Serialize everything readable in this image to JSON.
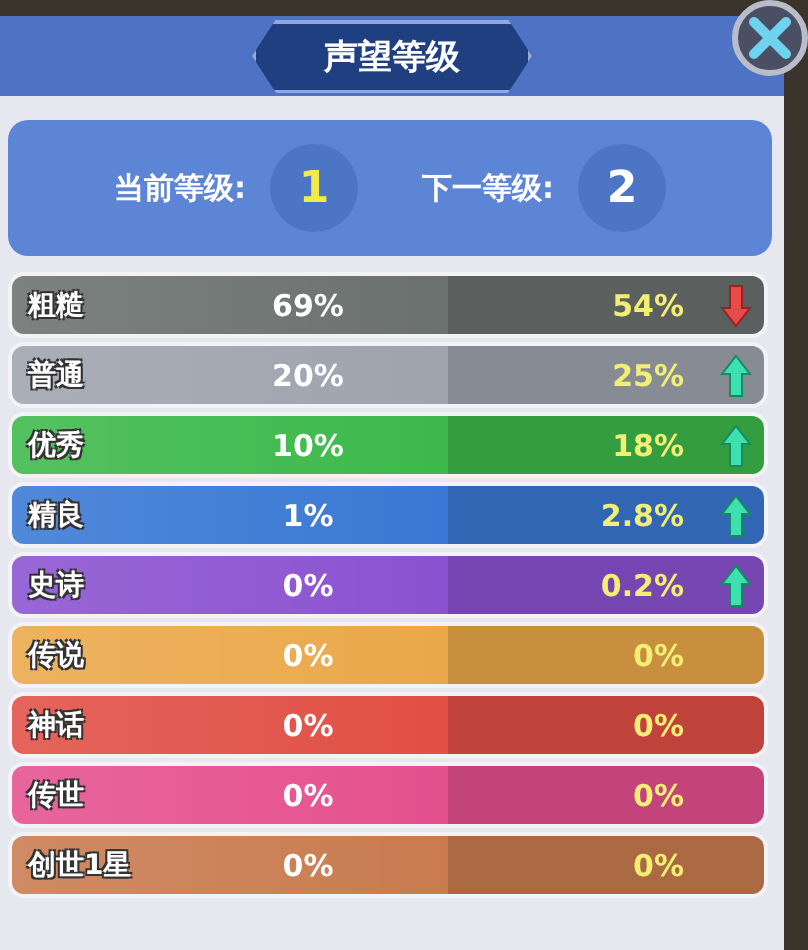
{
  "title": "声望等级",
  "levels": {
    "current_label": "当前等级:",
    "current": "1",
    "next_label": "下一等级:",
    "next": "2"
  },
  "rows": [
    {
      "kind": "down",
      "name": "粗糙",
      "now": "69%",
      "next": "54%",
      "color": "#6b716f"
    },
    {
      "kind": "up",
      "name": "普通",
      "now": "20%",
      "next": "25%",
      "color": "#9ea3ae"
    },
    {
      "kind": "up",
      "name": "优秀",
      "now": "10%",
      "next": "18%",
      "color": "#3cb94a"
    },
    {
      "kind": "up",
      "name": "精良",
      "now": "1%",
      "next": "2.8%",
      "color": "#3978d4"
    },
    {
      "kind": "up",
      "name": "史诗",
      "now": "0%",
      "next": "0.2%",
      "color": "#8a52d0"
    },
    {
      "kind": "plain",
      "name": "传说",
      "now": "0%",
      "next": "0%",
      "color": "#eba84a"
    },
    {
      "kind": "plain",
      "name": "神话",
      "now": "0%",
      "next": "0%",
      "color": "#e14f45"
    },
    {
      "kind": "plain",
      "name": "传世",
      "now": "0%",
      "next": "0%",
      "color": "#e5508f"
    },
    {
      "kind": "plain",
      "name": "创世1星",
      "now": "0%",
      "next": "0%",
      "color": "#c97b4f"
    }
  ]
}
